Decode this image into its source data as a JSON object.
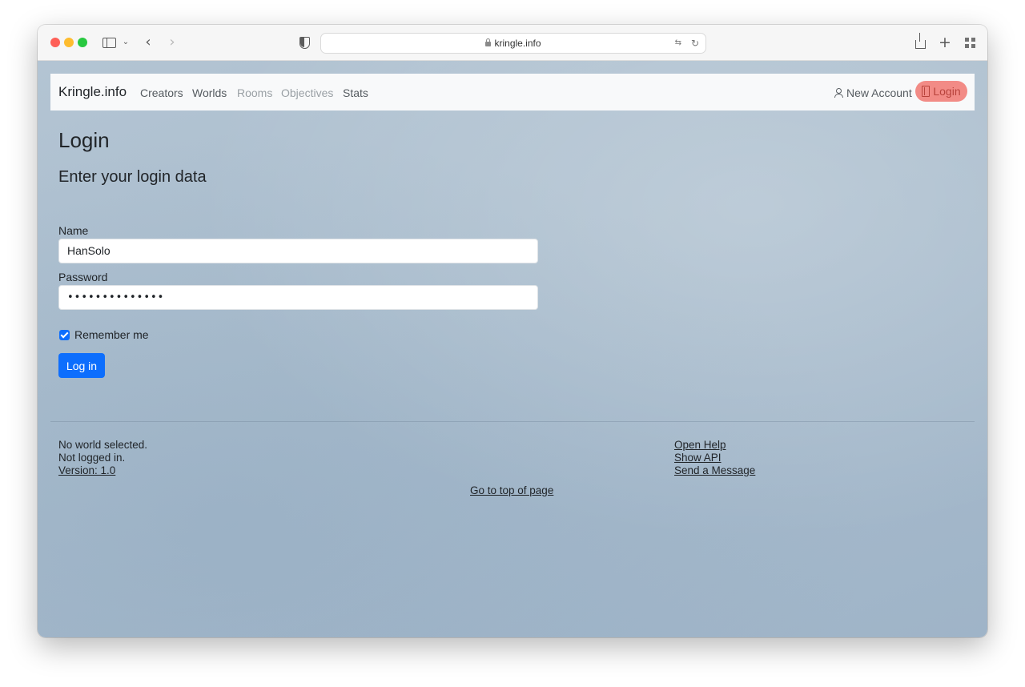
{
  "browser": {
    "url": "kringle.info"
  },
  "navbar": {
    "brand": "Kringle.info",
    "links": [
      {
        "label": "Creators",
        "enabled": true
      },
      {
        "label": "Worlds",
        "enabled": true
      },
      {
        "label": "Rooms",
        "enabled": false
      },
      {
        "label": "Objectives",
        "enabled": false
      },
      {
        "label": "Stats",
        "enabled": true
      }
    ],
    "new_account": "New Account",
    "login": "Login",
    "login_highlight_color": "#f28b86"
  },
  "main": {
    "title": "Login",
    "subtitle": "Enter your login data",
    "name_label": "Name",
    "name_value": "HanSolo",
    "password_label": "Password",
    "password_mask": "••••••••••••••",
    "remember_label": "Remember me",
    "remember_checked": true,
    "submit_label": "Log in",
    "accent_color": "#0d6efd"
  },
  "footer": {
    "world_status": "No world selected.",
    "login_status": "Not logged in.",
    "version": "Version: 1.0",
    "links": [
      "Open Help",
      "Show API",
      "Send a Message"
    ],
    "top_link": "Go to top of page"
  }
}
